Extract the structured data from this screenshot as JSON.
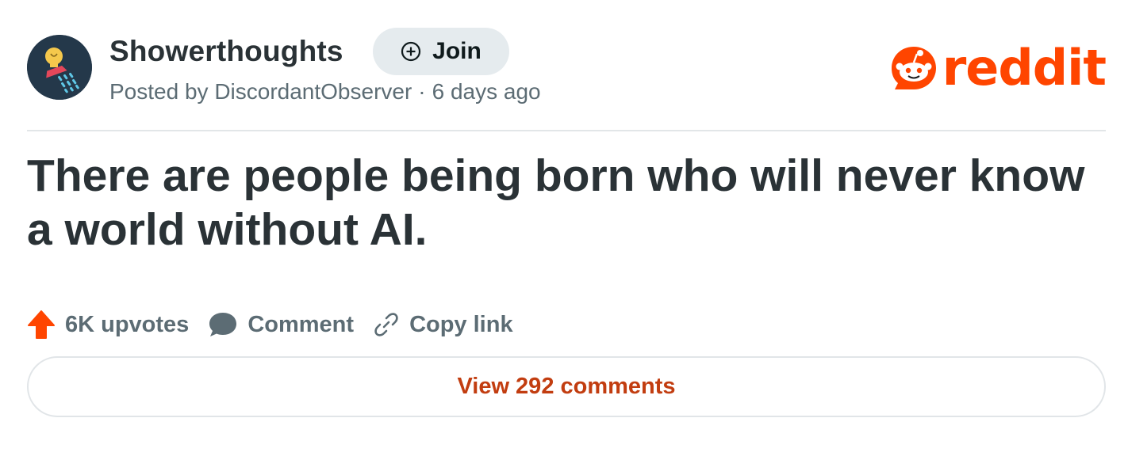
{
  "header": {
    "subreddit": "Showerthoughts",
    "join_label": "Join",
    "posted_by_prefix": "Posted by",
    "author": "DiscordantObserver",
    "separator": "·",
    "time_ago": "6 days ago",
    "logo_text": "reddit"
  },
  "post": {
    "title": "There are people being born who will never know a world without AI."
  },
  "actions": {
    "upvotes_label": "6K upvotes",
    "comment_label": "Comment",
    "copy_link_label": "Copy link"
  },
  "footer": {
    "view_comments_label": "View 292 comments"
  },
  "icons": {
    "avatar": "lightbulb-shower-icon",
    "join": "plus-circle-icon",
    "logo": "reddit-snoo-icon",
    "upvote": "upvote-arrow-icon",
    "comment": "comment-bubble-icon",
    "copy_link": "link-icon"
  },
  "colors": {
    "brand": "#ff4500",
    "text": "#2a3236",
    "muted": "#5c6c74",
    "join_bg": "#e5ebee",
    "link_accent": "#c23d10"
  }
}
